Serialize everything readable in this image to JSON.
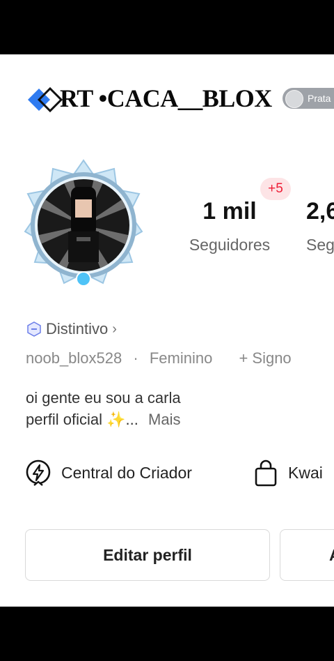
{
  "header": {
    "title": "RT •CACA__BLOX",
    "level_badge": "Prata"
  },
  "stats": [
    {
      "value": "1 mil",
      "label": "Seguidores"
    },
    {
      "value": "2,6",
      "label": "Seg"
    }
  ],
  "new_followers_badge": "+5",
  "profile": {
    "badge_label": "Distintivo",
    "username": "noob_blox528",
    "separator": "·",
    "gender": "Feminino",
    "sign_link": "+ Signo",
    "bio_line1": "oi gente eu sou a carla",
    "bio_line2": "perfil oficial ✨...",
    "more_label": "Mais"
  },
  "links": {
    "creator_center": "Central do Criador",
    "shop": "Kwai"
  },
  "buttons": {
    "edit_profile": "Editar perfil",
    "second": "A"
  },
  "colors": {
    "accent_red": "#ee1d36",
    "logo_blue": "#2f7bf0",
    "badge_gray": "#9ea2a8",
    "frame_light_blue": "#bfe0f5"
  }
}
